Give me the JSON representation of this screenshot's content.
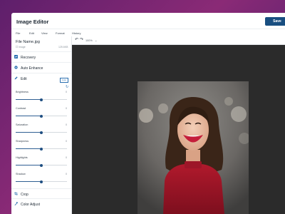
{
  "app": {
    "title": "Image Editor",
    "save_label": "Save"
  },
  "menu": [
    "File",
    "Edit",
    "View",
    "Format",
    "History"
  ],
  "file": {
    "name": "File Name.jpg",
    "type": "Image",
    "size": "125.6KB"
  },
  "sidebar": {
    "recovery": "Recovery",
    "auto_enhance": "Auto Enhance",
    "edit": "Edit",
    "auto_badge": "Auto",
    "crop": "Crop",
    "color_adjust": "Color Adjust"
  },
  "sliders": [
    {
      "label": "Brightness",
      "value": "0",
      "level": 0.5
    },
    {
      "label": "Contrast",
      "value": "0",
      "level": 0.5
    },
    {
      "label": "Saturation",
      "value": "0",
      "level": 0.5
    },
    {
      "label": "Sharpness",
      "value": "0",
      "level": 0.5
    },
    {
      "label": "Highlights",
      "value": "0",
      "level": 0.5
    },
    {
      "label": "Shadow",
      "value": "0",
      "level": 0.5
    }
  ],
  "toolbar": {
    "zoom": "100%"
  },
  "colors": {
    "accent": "#184e80",
    "slider_fill": "#2f5f93",
    "canvas_bg": "#2b2b2b"
  },
  "icons": [
    "undo-icon",
    "redo-icon",
    "chevron-down-icon",
    "recovery-icon",
    "auto-enhance-icon",
    "edit-icon",
    "reset-icon",
    "crop-icon",
    "color-adjust-icon"
  ]
}
